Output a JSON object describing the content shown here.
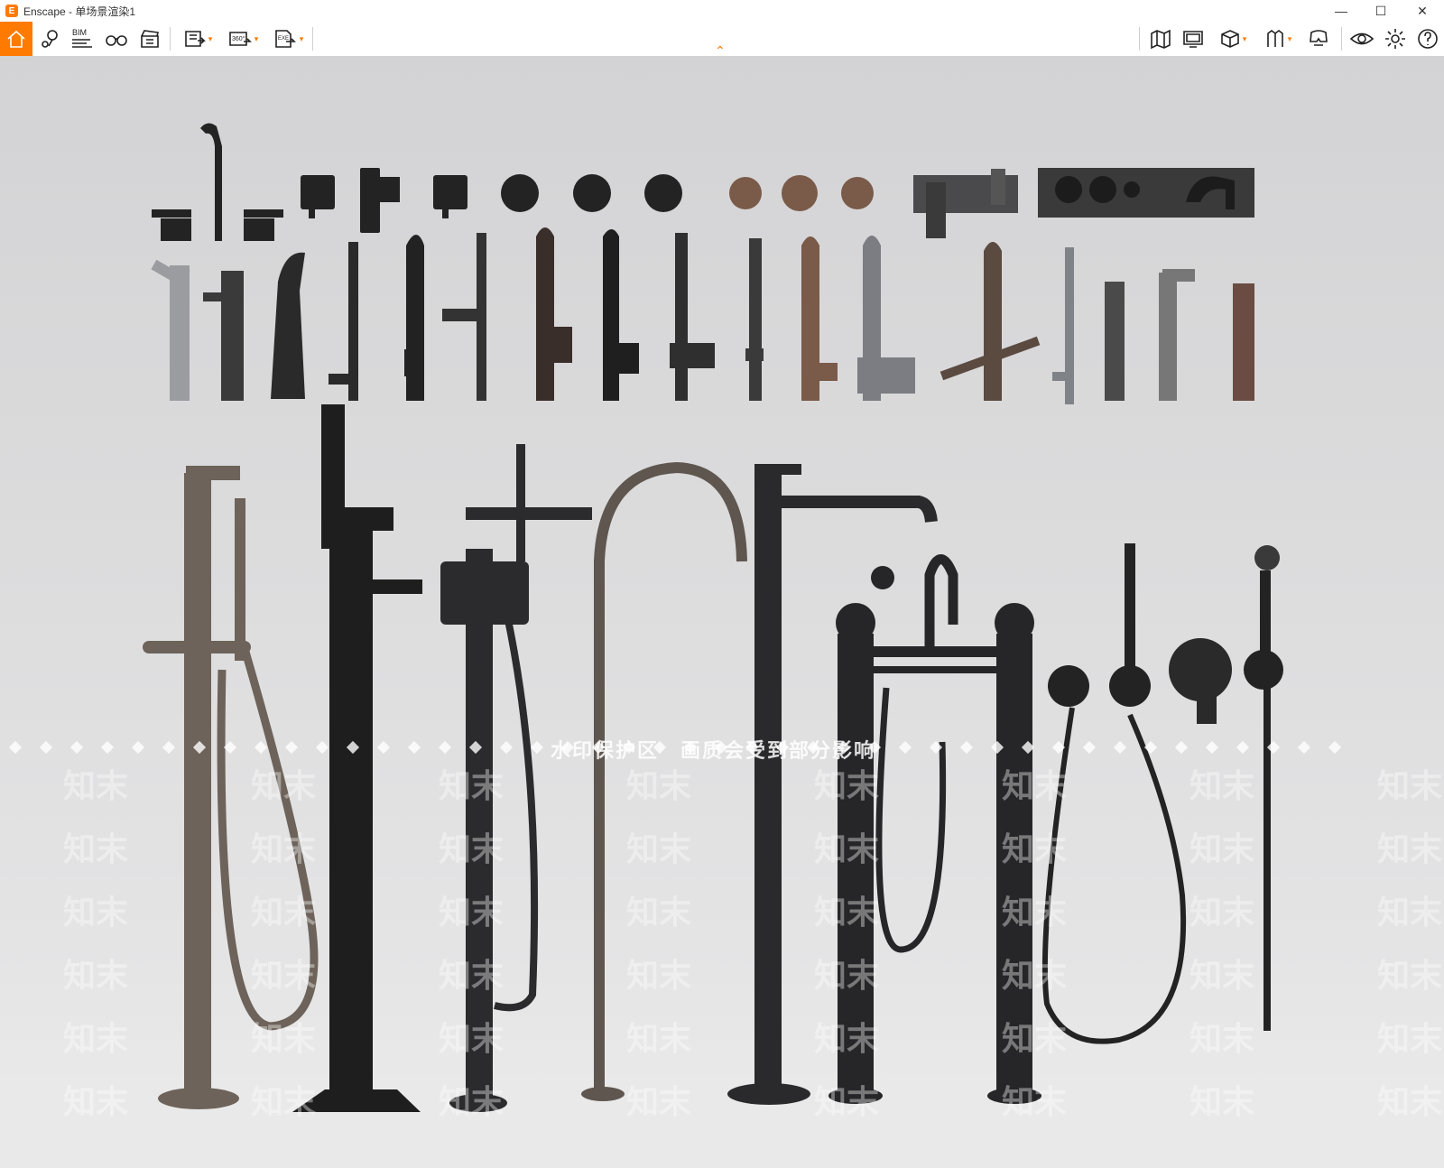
{
  "window": {
    "app_name": "Enscape",
    "separator": " - ",
    "doc_name": "单场景渲染1",
    "minimize": "—",
    "maximize": "☐",
    "close": "✕"
  },
  "toolbar": {
    "bim_label": "BIM",
    "pano_label": "360°",
    "exe_label": "EXE",
    "caret": "▾",
    "collapse_glyph": "⌃"
  },
  "watermark": {
    "notice": "水印保护区　画质会受到部分影响",
    "mark": "知末"
  },
  "colors": {
    "accent": "#ff7a00",
    "toolbar_bg": "#ffffff",
    "scene_bg": "#d8d8d9"
  },
  "icons": [
    "home-icon",
    "location-pin-icon",
    "bim-icon",
    "binoculars-icon",
    "clapperboard-icon",
    "screenshot-icon",
    "panorama-icon",
    "export-exe-icon",
    "map-icon",
    "monitor-icon",
    "cube-icon",
    "ruler-icon",
    "vr-headset-icon",
    "eye-icon",
    "gear-icon",
    "help-icon"
  ]
}
